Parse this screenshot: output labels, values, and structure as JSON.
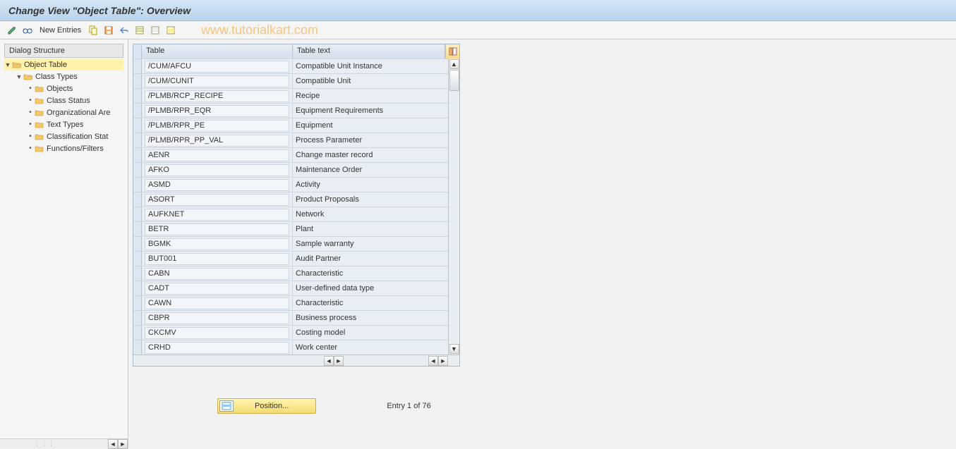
{
  "title": "Change View \"Object Table\": Overview",
  "watermark": "www.tutorialkart.com",
  "toolbar": {
    "new_entries": "New Entries"
  },
  "sidebar": {
    "header": "Dialog Structure",
    "tree": [
      {
        "label": "Object Table",
        "level": 0,
        "expanded": true,
        "selected": true,
        "open": true
      },
      {
        "label": "Class Types",
        "level": 1,
        "expanded": true,
        "open": true
      },
      {
        "label": "Objects",
        "level": 2
      },
      {
        "label": "Class Status",
        "level": 2
      },
      {
        "label": "Organizational Are",
        "level": 2
      },
      {
        "label": "Text Types",
        "level": 2
      },
      {
        "label": "Classification Stat",
        "level": 2
      },
      {
        "label": "Functions/Filters",
        "level": 2
      }
    ]
  },
  "table": {
    "columns": {
      "c1": "Table",
      "c2": "Table text"
    },
    "rows": [
      {
        "c1": "/CUM/AFCU",
        "c2": "Compatible Unit Instance"
      },
      {
        "c1": "/CUM/CUNIT",
        "c2": "Compatible Unit"
      },
      {
        "c1": "/PLMB/RCP_RECIPE",
        "c2": "Recipe"
      },
      {
        "c1": "/PLMB/RPR_EQR",
        "c2": "Equipment Requirements"
      },
      {
        "c1": "/PLMB/RPR_PE",
        "c2": "Equipment"
      },
      {
        "c1": "/PLMB/RPR_PP_VAL",
        "c2": "Process Parameter"
      },
      {
        "c1": "AENR",
        "c2": "Change master record"
      },
      {
        "c1": "AFKO",
        "c2": "Maintenance Order"
      },
      {
        "c1": "ASMD",
        "c2": "Activity"
      },
      {
        "c1": "ASORT",
        "c2": "Product Proposals"
      },
      {
        "c1": "AUFKNET",
        "c2": "Network"
      },
      {
        "c1": "BETR",
        "c2": "Plant"
      },
      {
        "c1": "BGMK",
        "c2": "Sample warranty"
      },
      {
        "c1": "BUT001",
        "c2": "Audit Partner"
      },
      {
        "c1": "CABN",
        "c2": "Characteristic"
      },
      {
        "c1": "CADT",
        "c2": "User-defined data type"
      },
      {
        "c1": "CAWN",
        "c2": "Characteristic"
      },
      {
        "c1": "CBPR",
        "c2": "Business process"
      },
      {
        "c1": "CKCMV",
        "c2": "Costing model"
      },
      {
        "c1": "CRHD",
        "c2": "Work center"
      }
    ]
  },
  "footer": {
    "position_label": "Position...",
    "entry_text": "Entry 1 of 76"
  }
}
